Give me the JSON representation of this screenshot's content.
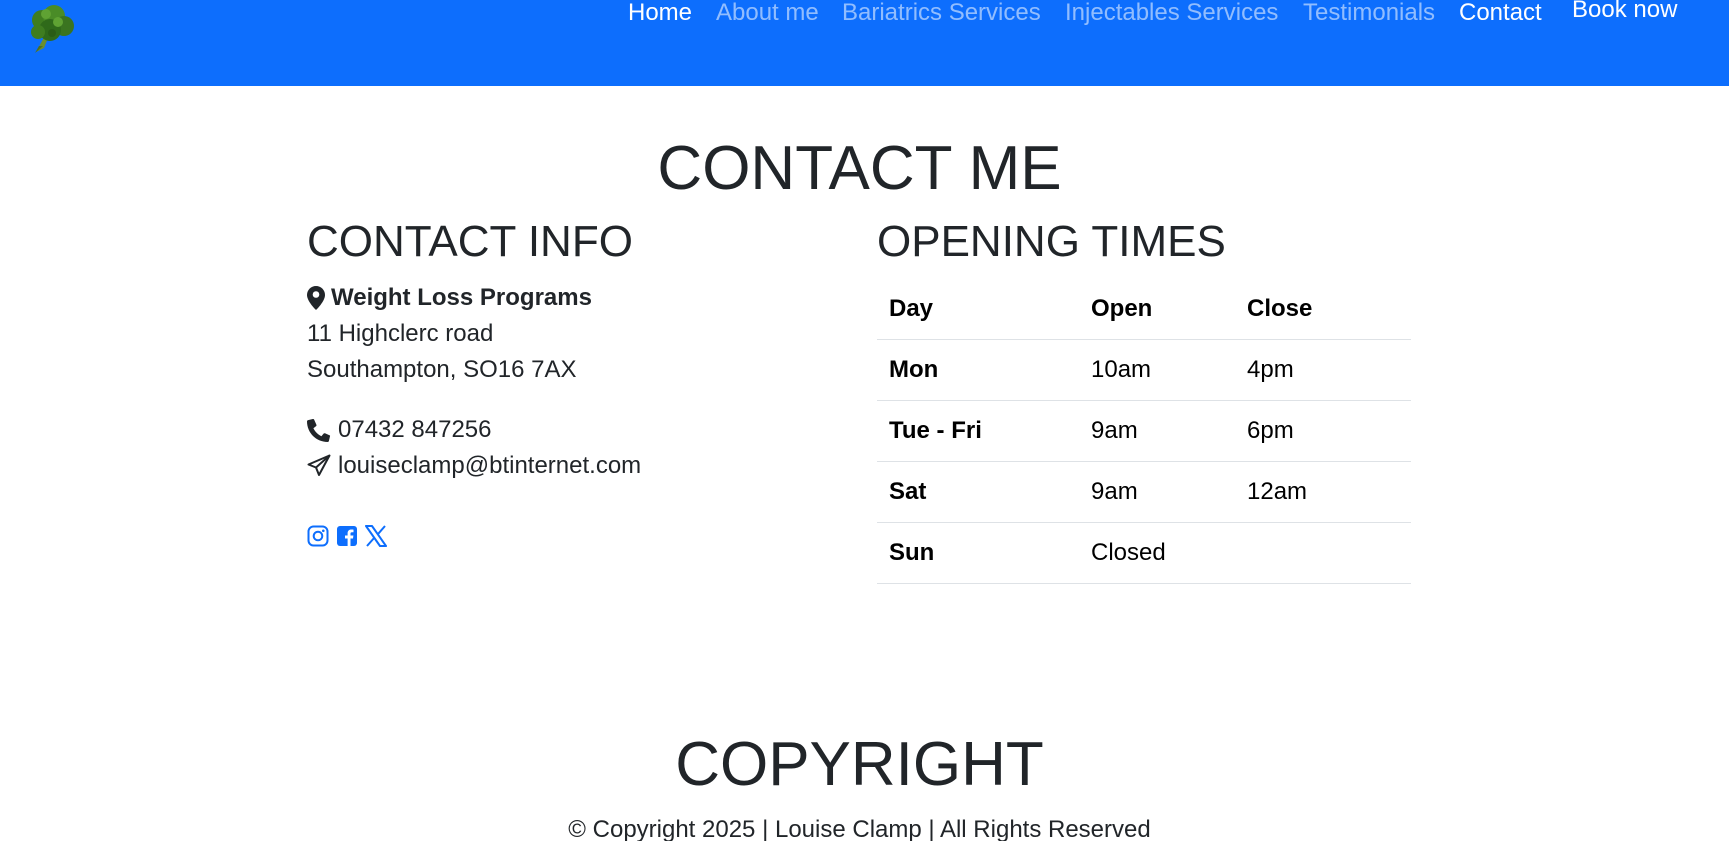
{
  "colors": {
    "nav_bg": "#0d6efd",
    "nav_link_inactive": "#9ec5fe",
    "nav_link_active": "#ffffff",
    "social_icons": "#0d6efd",
    "text": "#212529"
  },
  "nav": {
    "logo_icon": "broccoli-icon",
    "items": [
      {
        "label": "Home",
        "active": true
      },
      {
        "label": "About me",
        "active": false
      },
      {
        "label": "Bariatrics Services",
        "active": false
      },
      {
        "label": "Injectables Services",
        "active": false
      },
      {
        "label": "Testimonials",
        "active": false
      },
      {
        "label": "Contact",
        "active": true
      }
    ],
    "book_label": "Book now"
  },
  "page_title": "CONTACT ME",
  "contact_info": {
    "heading": "CONTACT INFO",
    "company": "Weight Loss Programs",
    "address_line1": "11 Highclerc road",
    "address_line2": "Southampton, SO16 7AX",
    "phone": "07432 847256",
    "email": "louiseclamp@btinternet.com",
    "icons": {
      "location": "map-marker-icon",
      "phone": "phone-icon",
      "email": "paper-plane-icon"
    },
    "socials": [
      "instagram-icon",
      "facebook-icon",
      "x-icon"
    ]
  },
  "opening_times": {
    "heading": "OPENING TIMES",
    "columns": [
      "Day",
      "Open",
      "Close"
    ],
    "rows": [
      {
        "day": "Mon",
        "open": "10am",
        "close": "4pm"
      },
      {
        "day": "Tue - Fri",
        "open": "9am",
        "close": "6pm"
      },
      {
        "day": "Sat",
        "open": "9am",
        "close": "12am"
      },
      {
        "day": "Sun",
        "open": "Closed",
        "close": ""
      }
    ]
  },
  "footer": {
    "heading": "COPYRIGHT",
    "text": "© Copyright 2025 | Louise Clamp | All Rights Reserved"
  }
}
